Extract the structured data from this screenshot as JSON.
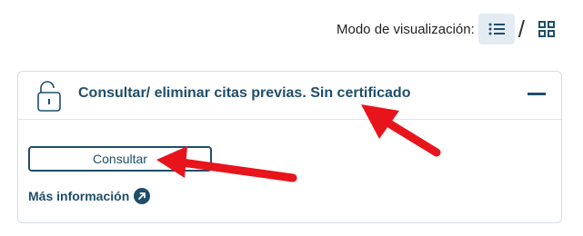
{
  "view_mode": {
    "label": "Modo de visualización:",
    "separator": "/",
    "options": [
      {
        "icon": "list-icon",
        "active": true
      },
      {
        "icon": "grid-icon",
        "active": false
      }
    ]
  },
  "card": {
    "icon": "unlocked-padlock-icon",
    "title": "Consultar/ eliminar citas previas. Sin certificado",
    "collapse_icon": "minus-icon",
    "consult_button": "Consultar",
    "more_info_link": "Más información",
    "more_info_icon": "arrow-up-right-circle-icon"
  },
  "annotations": {
    "arrow_color": "#e8141b",
    "arrows": [
      "arrow-to-title",
      "arrow-to-consult-button"
    ]
  },
  "colors": {
    "accent": "#1f4e6b",
    "active_view_bg": "#e4ecf3",
    "card_border": "#d6dde3"
  }
}
